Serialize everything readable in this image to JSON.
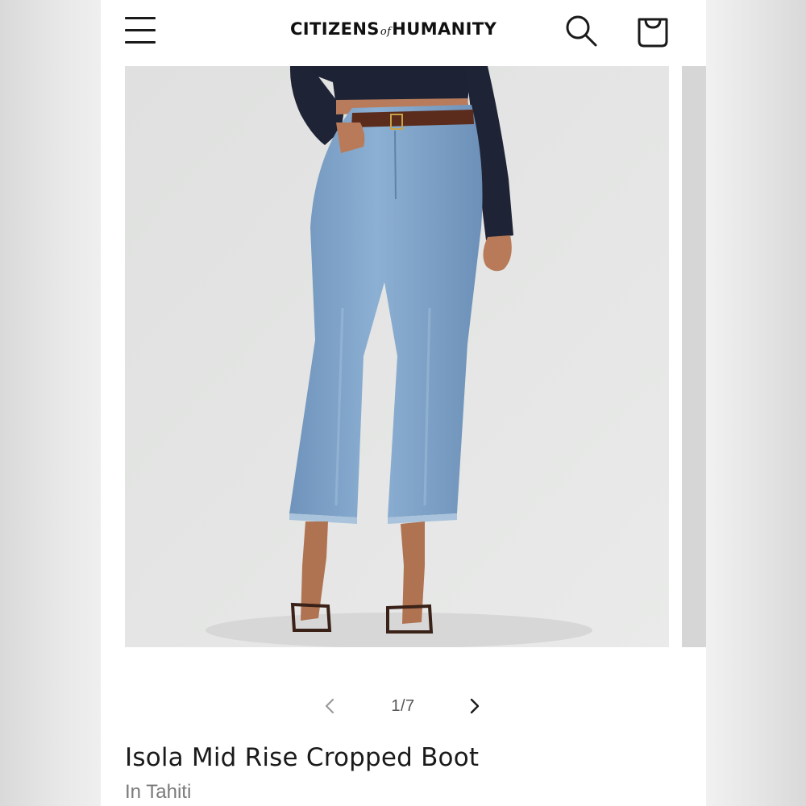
{
  "header": {
    "brand_left": "CITIZENS",
    "brand_of": "of",
    "brand_right": "HUMANITY",
    "menu_icon": "hamburger-menu-icon",
    "search_icon": "search-icon",
    "bag_icon": "shopping-bag-icon"
  },
  "gallery": {
    "image_alt": "Model wearing light-wash cropped bootcut jeans with brown belt and navy top",
    "pager": {
      "prev_icon": "chevron-left-icon",
      "next_icon": "chevron-right-icon",
      "count": "1/7"
    }
  },
  "product": {
    "title": "Isola Mid Rise Cropped Boot",
    "color": "In Tahiti"
  },
  "colors": {
    "text_primary": "#1a1a1a",
    "text_secondary": "#7a7a7a",
    "denim": "#7ea3c9",
    "background_photo": "#e4e5e4"
  }
}
